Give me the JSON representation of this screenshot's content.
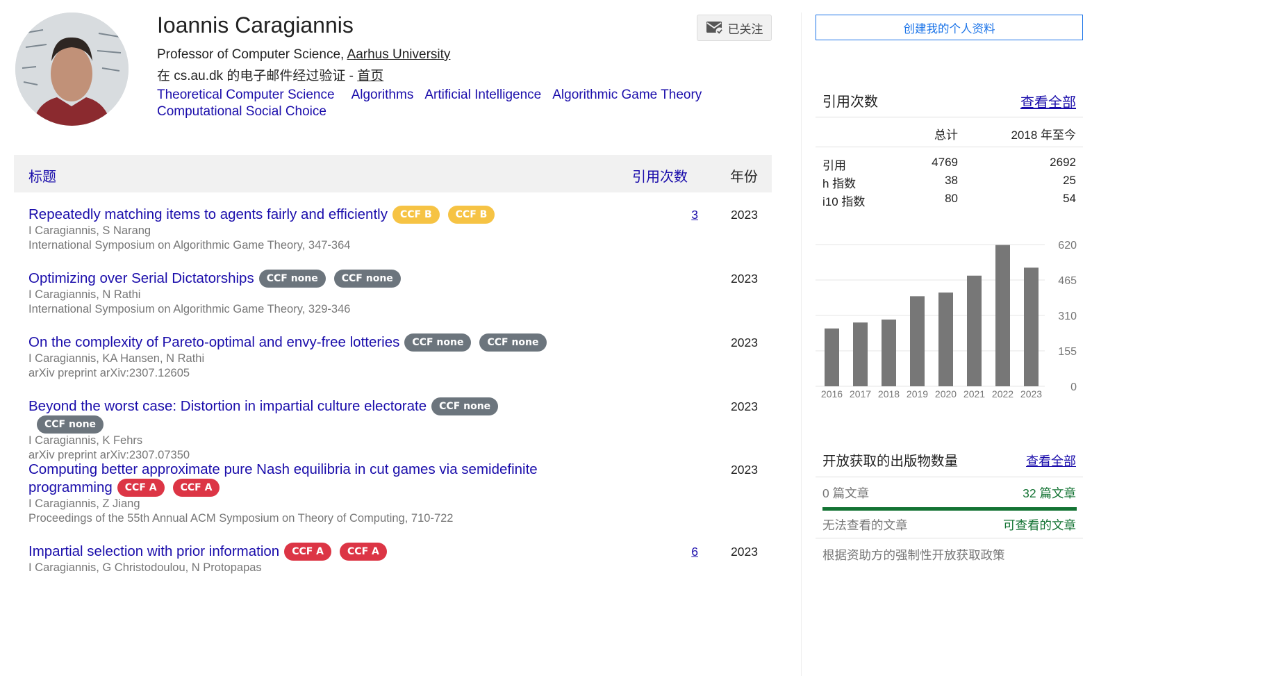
{
  "profile": {
    "name": "Ioannis Caragiannis",
    "affiliation_prefix": "Professor of Computer Science, ",
    "affiliation_link": "Aarhus University",
    "verified_text": "在 cs.au.dk 的电子邮件经过验证 - ",
    "homepage_link": "首页",
    "interests": [
      "Theoretical Computer Science",
      "Algorithms",
      "Artificial Intelligence",
      "Algorithmic Game Theory",
      "Computational Social Choice"
    ],
    "follow_label": "已关注"
  },
  "table": {
    "col_title": "标题",
    "col_cites": "引用次数",
    "col_year": "年份",
    "articles": [
      {
        "title": "Repeatedly matching items to agents fairly and efficiently",
        "badges": [
          {
            "text": "CCF B",
            "color": "yellow"
          },
          {
            "text": "CCF B",
            "color": "yellow"
          }
        ],
        "authors": "I Caragiannis, S Narang",
        "venue": "International Symposium on Algorithmic Game Theory, 347-364",
        "cites": "3",
        "year": "2023"
      },
      {
        "title": "Optimizing over Serial Dictatorships",
        "badges": [
          {
            "text": "CCF none",
            "color": "gray"
          },
          {
            "text": "CCF none",
            "color": "gray"
          }
        ],
        "authors": "I Caragiannis, N Rathi",
        "venue": "International Symposium on Algorithmic Game Theory, 329-346",
        "cites": "",
        "year": "2023"
      },
      {
        "title": "On the complexity of Pareto-optimal and envy-free lotteries",
        "badges": [
          {
            "text": "CCF none",
            "color": "gray"
          },
          {
            "text": "CCF none",
            "color": "gray"
          }
        ],
        "authors": "I Caragiannis, KA Hansen, N Rathi",
        "venue": "arXiv preprint arXiv:2307.12605",
        "cites": "",
        "year": "2023"
      },
      {
        "title": "Beyond the worst case: Distortion in impartial culture electorate",
        "badges": [
          {
            "text": "CCF none",
            "color": "gray"
          },
          {
            "text": "CCF none",
            "color": "gray"
          }
        ],
        "authors": "I Caragiannis, K Fehrs",
        "venue": "arXiv preprint arXiv:2307.07350",
        "cites": "",
        "year": "2023"
      },
      {
        "title": "Computing better approximate pure Nash equilibria in cut games via semidefinite programming",
        "badges": [
          {
            "text": "CCF A",
            "color": "red"
          },
          {
            "text": "CCF A",
            "color": "red"
          }
        ],
        "authors": "I Caragiannis, Z Jiang",
        "venue": "Proceedings of the 55th Annual ACM Symposium on Theory of Computing, 710-722",
        "cites": "",
        "year": "2023"
      },
      {
        "title": "Impartial selection with prior information",
        "badges": [
          {
            "text": "CCF A",
            "color": "red"
          },
          {
            "text": "CCF A",
            "color": "red"
          }
        ],
        "authors": "I Caragiannis, G Christodoulou, N Protopapas",
        "venue": "",
        "cites": "6",
        "year": "2023"
      }
    ]
  },
  "sidebar": {
    "create_profile": "创建我的个人资料",
    "citations_heading": "引用次数",
    "view_all": "查看全部",
    "col_total": "总计",
    "col_since": "2018 年至今",
    "stats": [
      {
        "label": "引用",
        "total": "4769",
        "since": "2692"
      },
      {
        "label": "h 指数",
        "total": "38",
        "since": "25"
      },
      {
        "label": "i10 指数",
        "total": "80",
        "since": "54"
      }
    ],
    "open_access": {
      "heading": "开放获取的出版物数量",
      "view_all": "查看全部",
      "unavailable_count": "0 篇文章",
      "available_count": "32 篇文章",
      "unavailable_label": "无法查看的文章",
      "available_label": "可查看的文章",
      "policy": "根据资助方的强制性开放获取政策"
    }
  },
  "colors": {
    "link": "#1a0dab",
    "bar": "#777777",
    "oa_green": "#137333",
    "ccf_a": "#dc3545",
    "ccf_b": "#f6c344",
    "ccf_none": "#6c757d"
  },
  "chart_data": {
    "type": "bar",
    "categories": [
      "2016",
      "2017",
      "2018",
      "2019",
      "2020",
      "2021",
      "2022",
      "2023"
    ],
    "values": [
      253,
      279,
      292,
      394,
      410,
      484,
      618,
      519
    ],
    "yticks": [
      0,
      155,
      310,
      465,
      620
    ],
    "ylim": [
      0,
      620
    ],
    "grid": true,
    "title": "",
    "xlabel": "",
    "ylabel": ""
  }
}
